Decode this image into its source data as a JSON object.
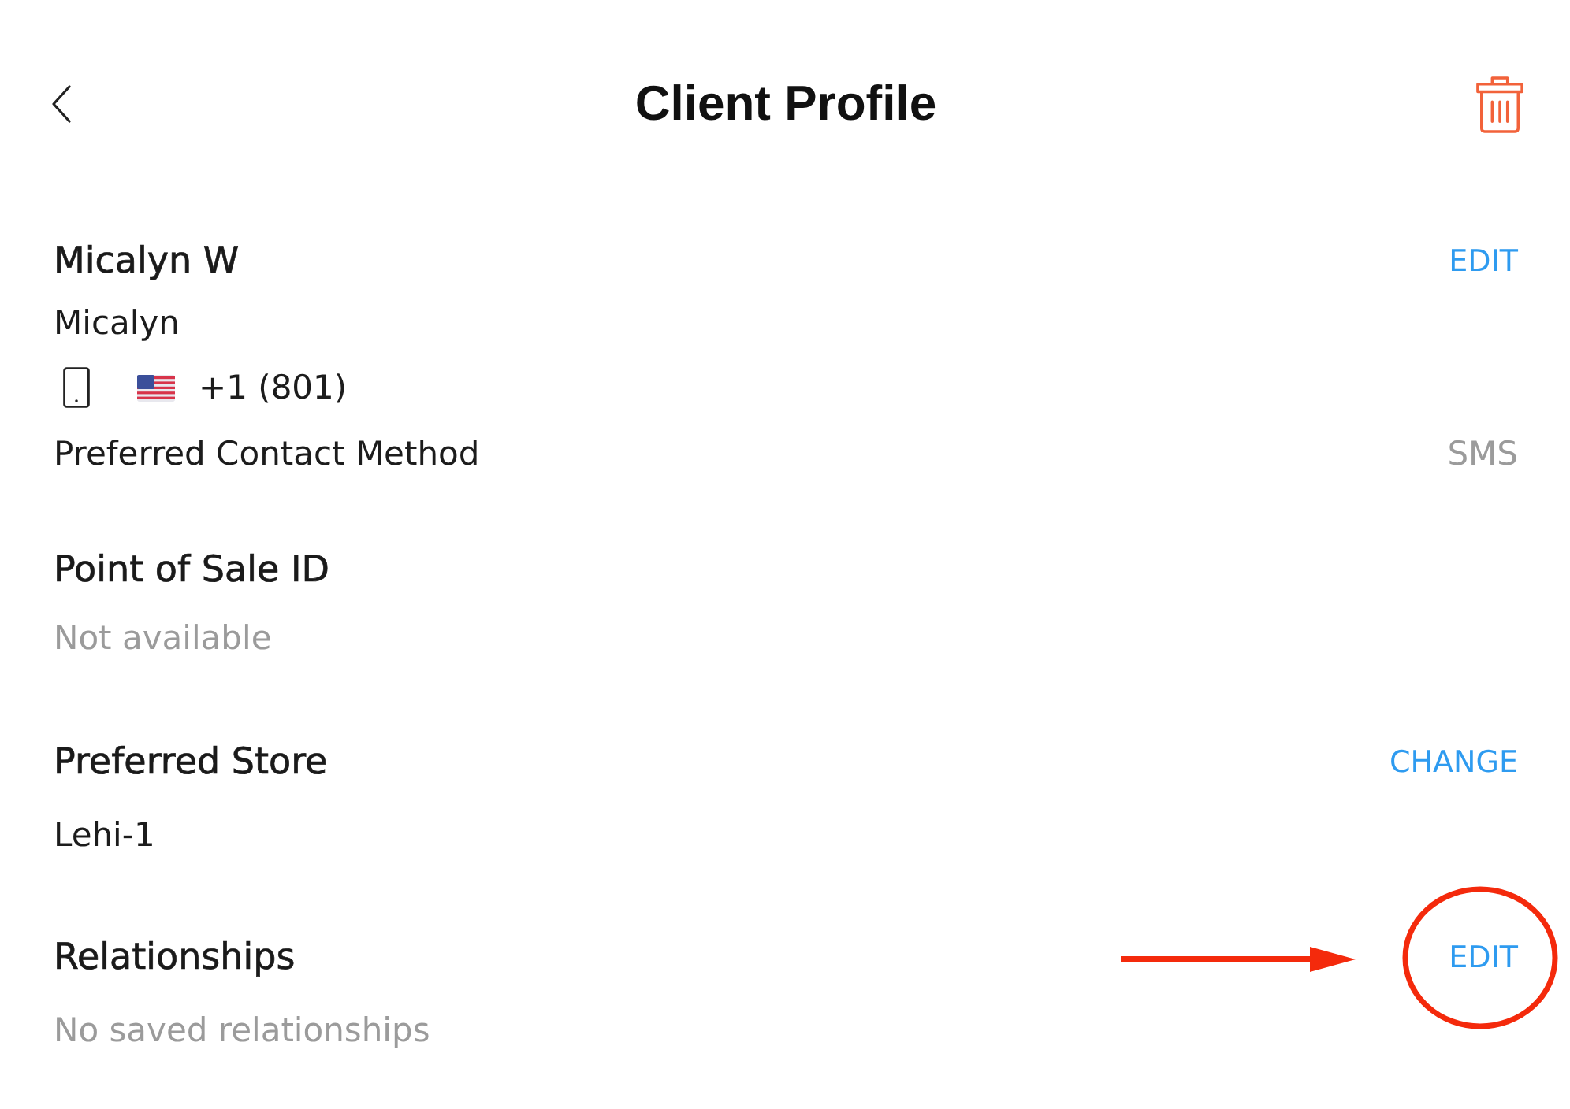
{
  "header": {
    "title": "Client Profile"
  },
  "client": {
    "name": "Micalyn W",
    "action": "EDIT",
    "first_name": "Micalyn",
    "phone": "+1 (801)",
    "contact_label": "Preferred Contact Method",
    "contact_value": "SMS"
  },
  "sections": [
    {
      "title": "Point of Sale ID",
      "value": "Not available",
      "muted": true,
      "highlighted": false
    },
    {
      "title": "Preferred Store",
      "action": "CHANGE",
      "value": "Lehi-1",
      "muted": false,
      "highlighted": false
    },
    {
      "title": "Relationships",
      "action": "EDIT",
      "value": "No saved relationships",
      "muted": true,
      "highlighted": true
    }
  ]
}
